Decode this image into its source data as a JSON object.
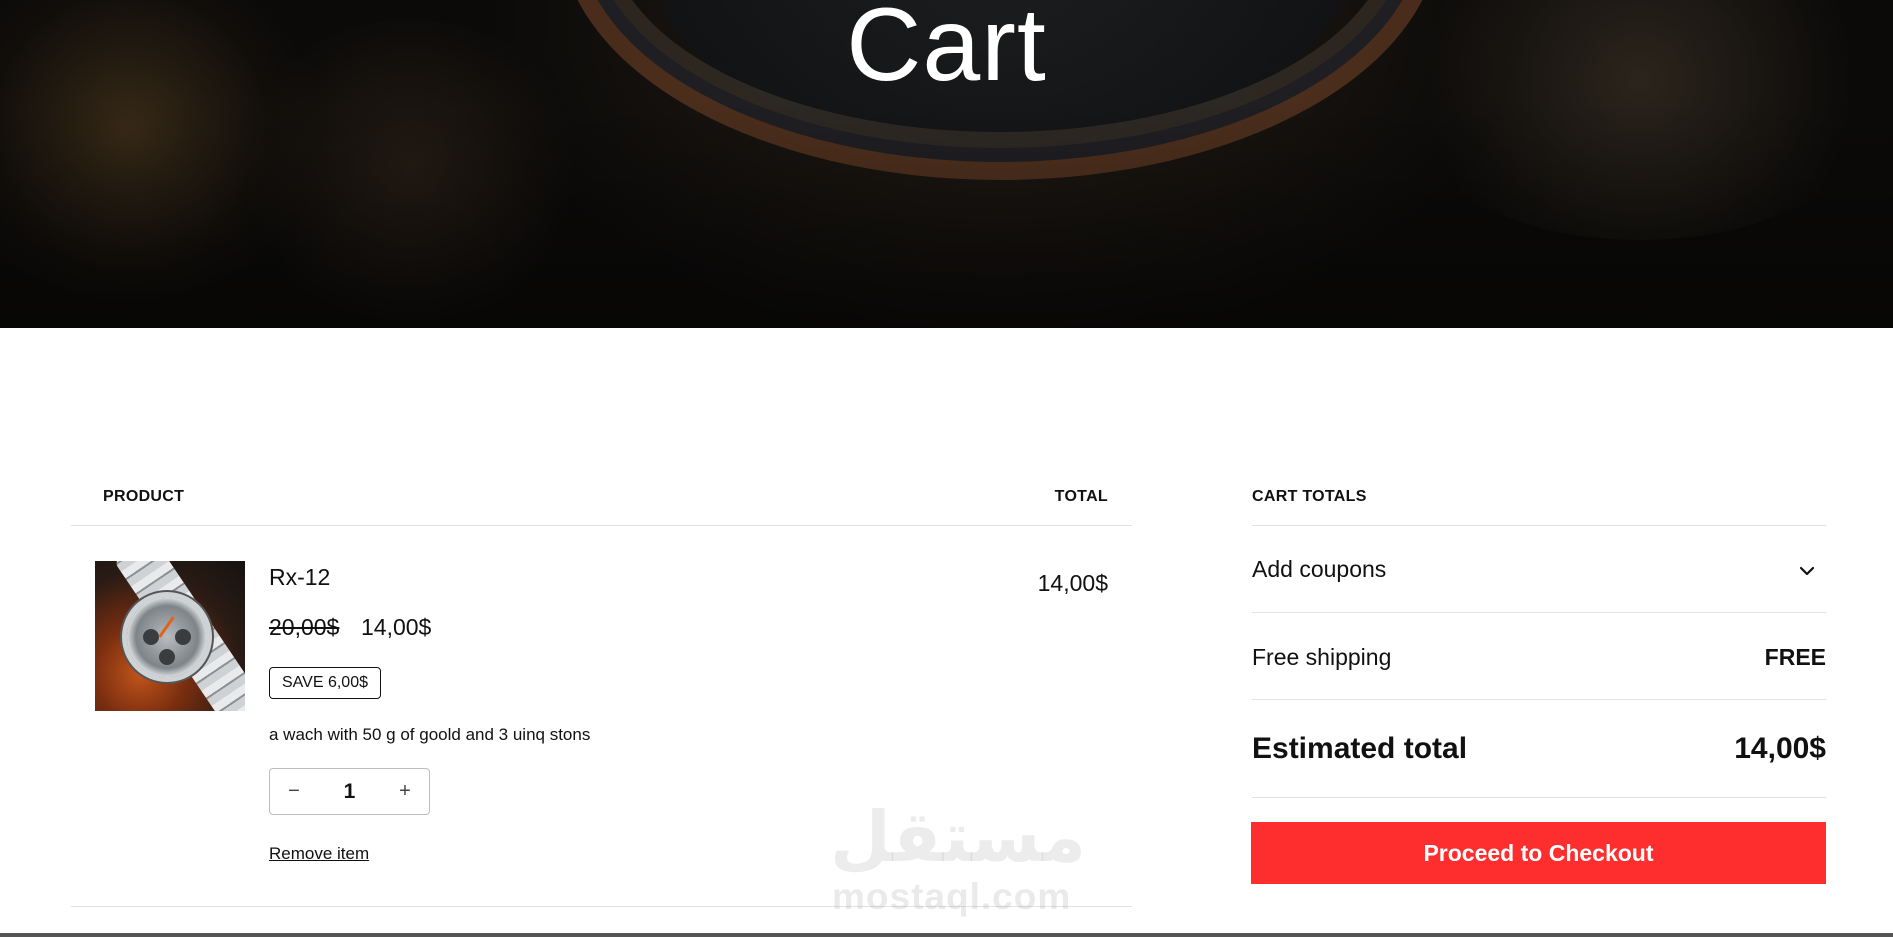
{
  "hero": {
    "title": "Cart"
  },
  "table": {
    "header_product": "PRODUCT",
    "header_total": "TOTAL"
  },
  "item": {
    "name": "Rx-12",
    "original_price": "20,00$",
    "sale_price": "14,00$",
    "save_badge": "SAVE 6,00$",
    "description": "a wach with 50 g of goold and 3  uinq stons",
    "quantity": "1",
    "decrement_symbol": "−",
    "increment_symbol": "+",
    "remove_label": "Remove item",
    "line_total": "14,00$"
  },
  "totals": {
    "header": "CART TOTALS",
    "coupons_label": "Add coupons",
    "shipping_label": "Free shipping",
    "shipping_value": "FREE",
    "estimated_label": "Estimated total",
    "estimated_value": "14,00$",
    "checkout_label": "Proceed to Checkout"
  },
  "watermark": {
    "arabic": "مستقل",
    "latin": "mostaql.com"
  },
  "colors": {
    "checkout": "#ff2e2e",
    "text": "#111111",
    "divider": "#e2e2e2"
  },
  "icons": {
    "coupons_toggle": "chevron-down-icon"
  }
}
